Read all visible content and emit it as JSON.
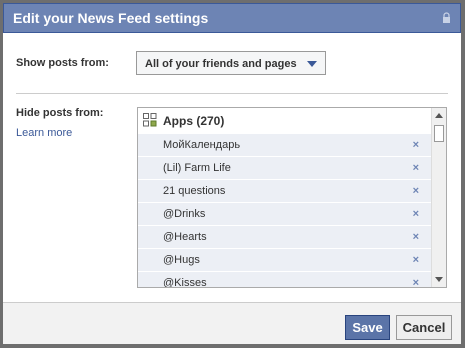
{
  "dialog": {
    "title": "Edit your News Feed settings"
  },
  "show_posts": {
    "label": "Show posts from:",
    "selected": "All of your friends and pages"
  },
  "hide_posts": {
    "label": "Hide posts from:",
    "learn_more": "Learn more",
    "group_title": "Apps (270)",
    "items": [
      "МойКалендарь",
      "(Lil) Farm Life",
      "21 questions",
      "@Drinks",
      "@Hearts",
      "@Hugs",
      "@Kisses"
    ],
    "remove_glyph": "×"
  },
  "footer": {
    "save_label": "Save",
    "cancel_label": "Cancel"
  },
  "colors": {
    "title_bar": "#6d84b4",
    "primary_button": "#5b74a8",
    "list_item_bg": "#eceff5",
    "link": "#3b5998"
  }
}
